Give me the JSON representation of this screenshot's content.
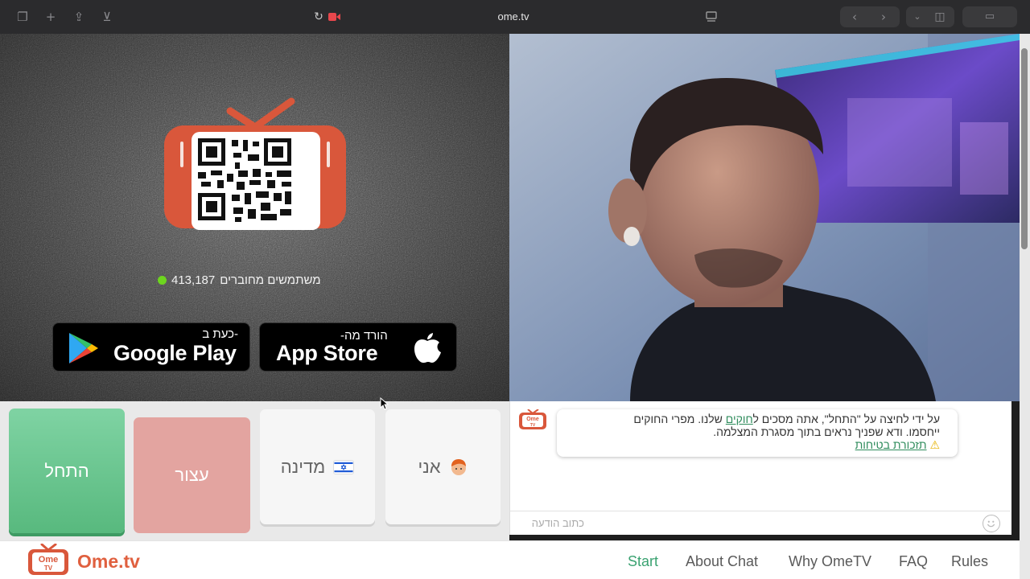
{
  "browser": {
    "url": "ome.tv"
  },
  "promo": {
    "online_count": "413,187",
    "online_label": "משתמשים מחוברים",
    "google_small": "כעת ב-",
    "google_big": "Google Play",
    "apple_small": "-הורד מה",
    "apple_big": "App Store"
  },
  "controls": {
    "start": "התחל",
    "stop": "עצור",
    "country": "מדינה",
    "me": "אני"
  },
  "chat": {
    "line1_a": "על ידי לחיצה על \"התחל\", אתה מסכים ל",
    "rules_link": "חוקים",
    "line1_b": " שלנו. מפרי החוקים",
    "line2": "ייחסמו. ודא שפניך נראים בתוך מסגרת המצלמה.",
    "safety_link": "תזכורת בטיחות",
    "placeholder": "כתוב הודעה"
  },
  "footer": {
    "brand": "Ome.tv",
    "logo_text_1": "Ome",
    "logo_text_2": "TV",
    "nav": [
      "Start",
      "About Chat",
      "Why OmeTV",
      "FAQ",
      "Rules"
    ]
  },
  "colors": {
    "accent": "#3aa271",
    "brand": "#e0603f",
    "tv": "#d9573b"
  }
}
